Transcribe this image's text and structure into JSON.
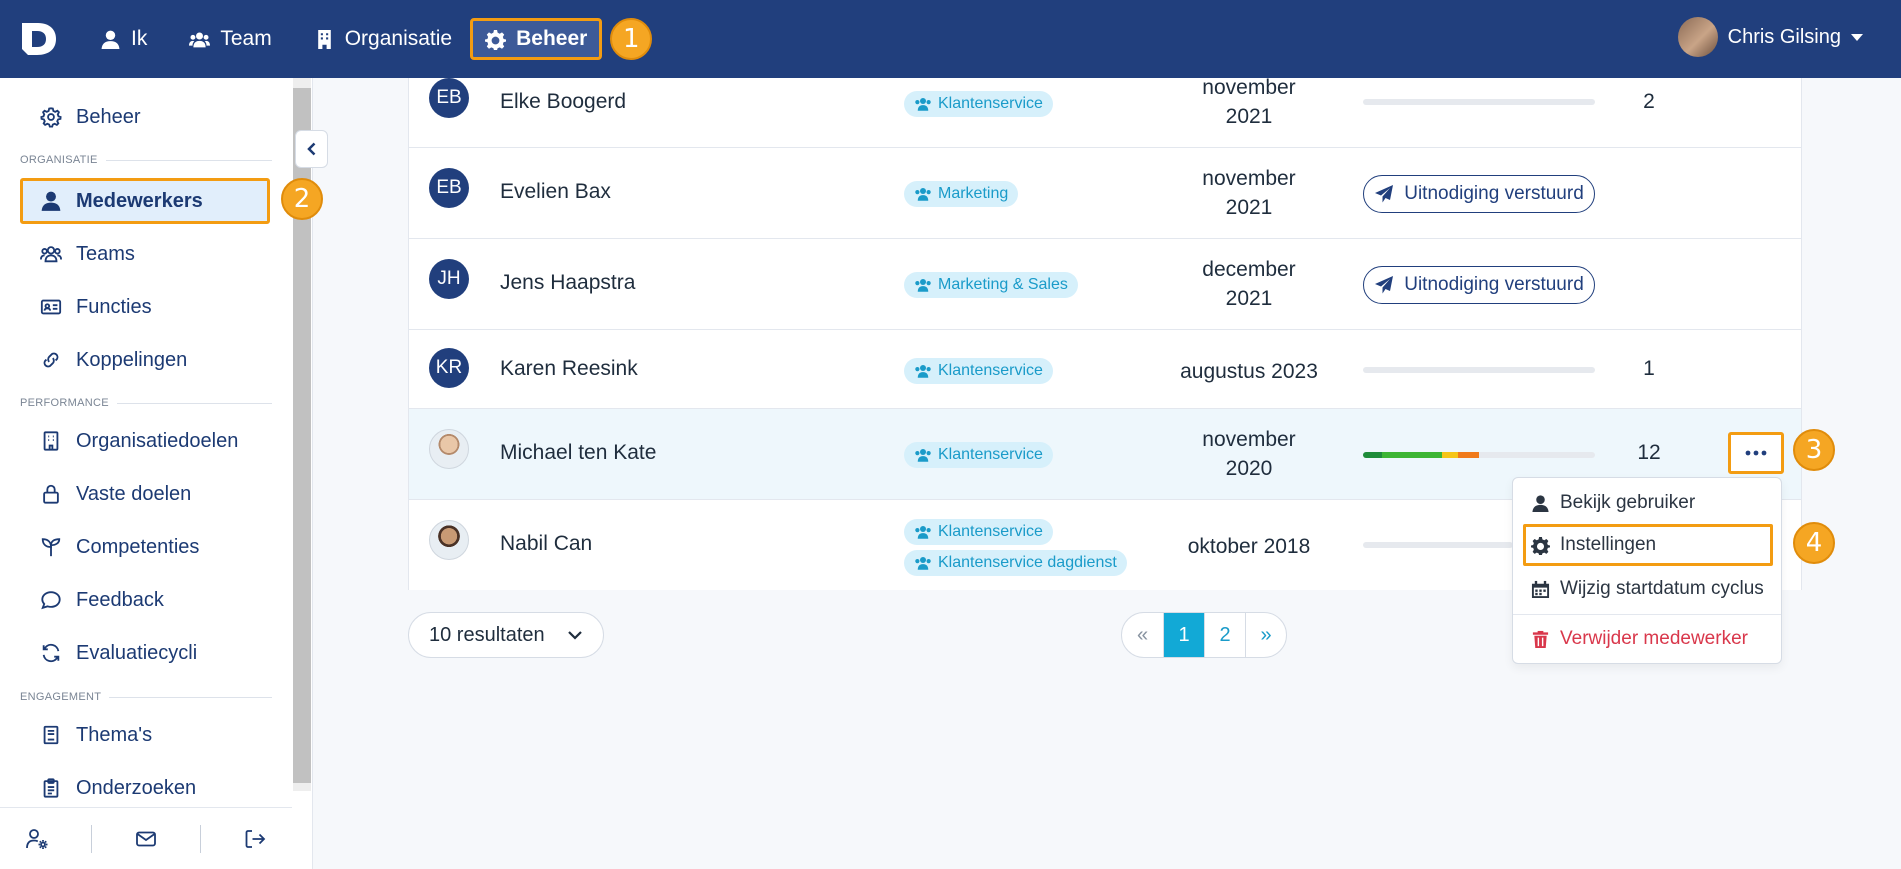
{
  "colors": {
    "navy": "#213f7d",
    "accent": "#f39c12",
    "cyan": "#12a9d6",
    "danger": "#d9374b"
  },
  "topbar": {
    "logo": "D",
    "nav": [
      {
        "label": "Ik",
        "icon": "user-icon"
      },
      {
        "label": "Team",
        "icon": "users-icon"
      },
      {
        "label": "Organisatie",
        "icon": "building-icon"
      },
      {
        "label": "Beheer",
        "icon": "gear-icon",
        "active": true
      }
    ],
    "user_name": "Chris Gilsing"
  },
  "badges": {
    "b1": "1",
    "b2": "2",
    "b3": "3",
    "b4": "4"
  },
  "sidebar": {
    "top_item": "Beheer",
    "sections": {
      "organisatie": "ORGANISATIE",
      "performance": "PERFORMANCE",
      "engagement": "ENGAGEMENT"
    },
    "items": {
      "medewerkers": "Medewerkers",
      "teams": "Teams",
      "functies": "Functies",
      "koppelingen": "Koppelingen",
      "organisatiedoelen": "Organisatiedoelen",
      "vaste_doelen": "Vaste doelen",
      "competenties": "Competenties",
      "feedback": "Feedback",
      "evaluatiecycli": "Evaluatiecycli",
      "themas": "Thema's",
      "onderzoeken": "Onderzoeken"
    }
  },
  "rows": [
    {
      "initials": "EB",
      "name": "Elke Boogerd",
      "tags": [
        "Klantenservice"
      ],
      "date_line1": "november",
      "date_line2": "2021",
      "progress": 0,
      "count": "2"
    },
    {
      "initials": "EB",
      "name": "Evelien Bax",
      "tags": [
        "Marketing"
      ],
      "date_line1": "november",
      "date_line2": "2021",
      "invite": "Uitnodiging verstuurd"
    },
    {
      "initials": "JH",
      "name": "Jens Haapstra",
      "tags": [
        "Marketing & Sales"
      ],
      "date_line1": "december",
      "date_line2": "2021",
      "invite": "Uitnodiging verstuurd"
    },
    {
      "initials": "KR",
      "name": "Karen Reesink",
      "tags": [
        "Klantenservice"
      ],
      "date": "augustus 2023",
      "progress": 0,
      "count": "1"
    },
    {
      "name": "Michael ten Kate",
      "tags": [
        "Klantenservice"
      ],
      "date_line1": "november",
      "date_line2": "2020",
      "progress": 0.5,
      "count": "12"
    },
    {
      "name": "Nabil Can",
      "tags": [
        "Klantenservice",
        "Klantenservice dagdienst"
      ],
      "date": "oktober 2018"
    }
  ],
  "progress_segments": [
    {
      "color": "#1e8c3a",
      "fraction": 0.08
    },
    {
      "color": "#3cb534",
      "fraction": 0.26
    },
    {
      "color": "#f5c518",
      "fraction": 0.07
    },
    {
      "color": "#f07a1a",
      "fraction": 0.09
    }
  ],
  "menu": {
    "view": "Bekijk gebruiker",
    "settings": "Instellingen",
    "change_cycle": "Wijzig startdatum cyclus",
    "delete": "Verwijder medewerker"
  },
  "footer": {
    "results": "10 resultaten",
    "pages": [
      "«",
      "1",
      "2",
      "»"
    ],
    "current_page": "1"
  }
}
